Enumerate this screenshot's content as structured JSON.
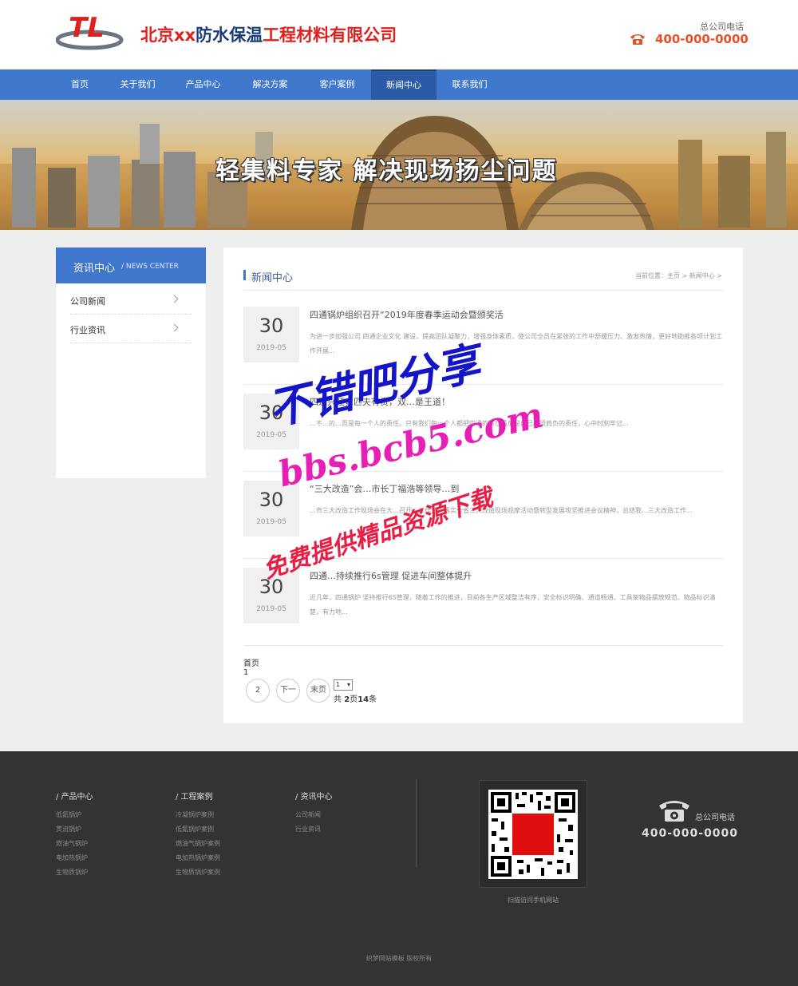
{
  "header": {
    "logo_text": "TL",
    "company_name_red1": "北京xx",
    "company_name_dark": "防水保温",
    "company_name_red2": "工程材料有限公司",
    "phone_label": "总公司电话",
    "phone_number": "400-000-0000"
  },
  "nav": {
    "items": [
      {
        "label": "首页"
      },
      {
        "label": "关于我们"
      },
      {
        "label": "产品中心"
      },
      {
        "label": "解决方案"
      },
      {
        "label": "客户案例"
      },
      {
        "label": "新闻中心"
      },
      {
        "label": "联系我们"
      }
    ],
    "active_index": 5
  },
  "banner": {
    "slogan": "轻集料专家 解决现场扬尘问题"
  },
  "sidebar": {
    "title": "资讯中心",
    "subtitle": "/ NEWS CENTER",
    "items": [
      {
        "label": "公司新闻"
      },
      {
        "label": "行业资讯"
      }
    ]
  },
  "main": {
    "title": "新闻中心",
    "breadcrumb": "当前位置：主页 > 新闻中心 >",
    "news": [
      {
        "day": "30",
        "ym": "2019-05",
        "title": "四通锅炉组织召开“2019年度春季运动会暨颁奖活",
        "desc": "为进一步加强公司 四通企业文化 建设，提高团队凝聚力，增强身体素质，使公司全员在紧张的工作中舒缓压力、激发热情，更好地助推各项计划工作开展..."
      },
      {
        "day": "30",
        "ym": "2019-05",
        "title": "四通兴旺，匹夫有责，双…是王道！",
        "desc": "…不…的…而是每一个人的责任。只有我们每一个人都把四通的兴亡看成是自己必须肩负的责任，心中时刻牢记..."
      },
      {
        "day": "30",
        "ym": "2019-05",
        "title": "“三大改造”会…市长丁福浩等领导…到",
        "desc": "…市三大改造工作现场会在大…召开…工作…，落实全省三大改造现场观摩活动暨转型发展攻坚推进会议精神，总结我…三大改造工作..."
      },
      {
        "day": "30",
        "ym": "2019-05",
        "title": "四通…持续推行6s管理 促进车间整体提升",
        "desc": "近几年，四通锅炉 坚持推行6S管理，随着工作的推进，目前各生产区域整洁有序，安全标识明确、通道畅通、工具架物品摆放规范、物品标识清楚，有力地..."
      }
    ],
    "pagination": {
      "first": "首页",
      "current": "1",
      "page2": "2",
      "next": "下一",
      "last": "末页",
      "select_value": "1",
      "total_prefix": "共 ",
      "total_pages": "2",
      "total_mid": "页",
      "total_items": "14",
      "total_suffix": "条"
    }
  },
  "watermark": {
    "line1": "不错吧分享",
    "line2": "bbs.bcb5.com",
    "line3": "免费提供精品资源下载"
  },
  "footer": {
    "col1": {
      "title": "/ 产品中心",
      "links": [
        "低氮锅炉",
        "贯流锅炉",
        "燃油气锅炉",
        "电加热锅炉",
        "生物质锅炉"
      ]
    },
    "col2": {
      "title": "/ 工程案例",
      "links": [
        "冷凝锅炉案例",
        "低氮锅炉案例",
        "燃油气锅炉案例",
        "电加热锅炉案例",
        "生物质锅炉案例"
      ]
    },
    "col3": {
      "title": "/ 资讯中心",
      "links": [
        "公司新闻",
        "行业资讯"
      ]
    },
    "qr_caption": "扫描访问手机网站",
    "phone_label": "总公司电话",
    "phone_number": "400-000-0000",
    "copyright": "织梦网站模板 版权所有"
  },
  "colors": {
    "nav_blue": "#3f77cd",
    "nav_active": "#2b5aa8",
    "brand_red": "#e0201d",
    "phone_orange": "#e8502a",
    "footer_bg": "#333333"
  }
}
